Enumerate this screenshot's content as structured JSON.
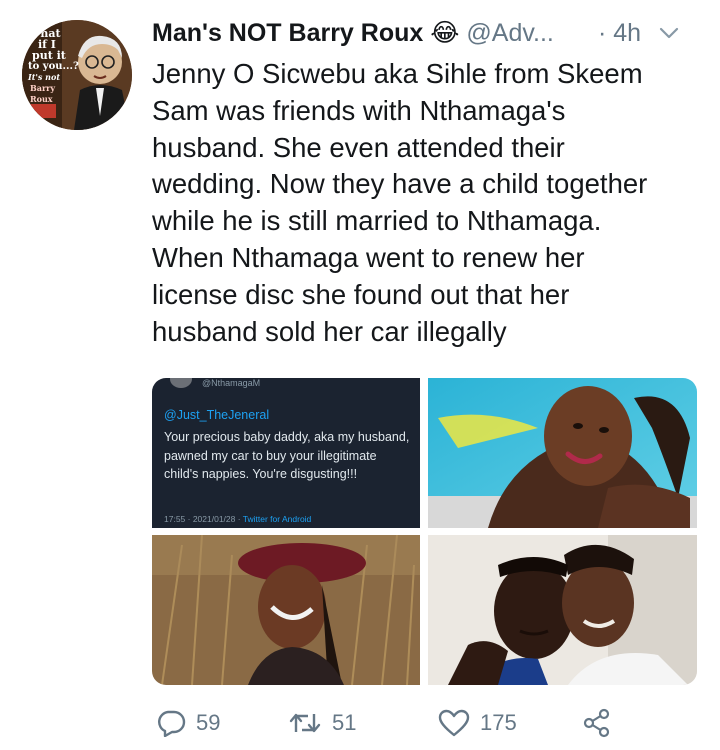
{
  "author": {
    "display_name": "Man's NOT Barry Roux 😂",
    "handle": "@Adv...",
    "separator": "·",
    "time": "4h",
    "avatar_caption": [
      "What",
      "if I",
      "put it",
      "to you...?",
      "It's not",
      "Barry",
      "Roux"
    ]
  },
  "tweet": {
    "lines": [
      "Jenny O Sicwebu aka Sihle from Skeem",
      "Sam was friends with Nthamaga's",
      "husband. She even attended their",
      "wedding. Now they have a child together",
      "while he is still married to Nthamaga.",
      "When Nthamaga went to renew her",
      "license disc she found out that her",
      "husband sold her car illegally"
    ]
  },
  "embedded_tweet": {
    "handle": "@NthamagaM",
    "reply_to": "@Just_TheJeneral",
    "text": "Your precious baby daddy, aka my husband, pawned my car to buy your illegitimate child's nappies. You're disgusting!!!",
    "timestamp": "17:55 · 2021/01/28 ·",
    "via": "Twitter for Android"
  },
  "actions": {
    "replies": "59",
    "retweets": "51",
    "likes": "175"
  },
  "colors": {
    "text": "#14171a",
    "muted": "#657786",
    "link": "#1da1f2",
    "dark_tile": "#1b2330"
  },
  "icons": [
    "reply-icon",
    "retweet-icon",
    "like-icon",
    "share-icon",
    "chevron-down-icon"
  ]
}
